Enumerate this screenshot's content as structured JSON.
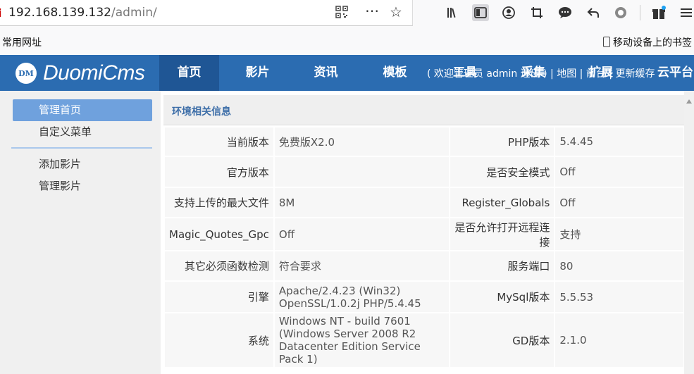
{
  "browser": {
    "url_host": "192.168.139.132",
    "url_path": "/admin/",
    "more_icon": "⋯",
    "star_icon": "☆",
    "toolbar_icons": [
      "library-icon",
      "sidebar-icon",
      "account-icon",
      "crop-icon",
      "chat-icon",
      "back-arrow-icon",
      "puzzle-icon",
      "gift-icon",
      "menu-icon"
    ]
  },
  "bookmarks": {
    "left_label": "常用网址",
    "right_label": "移动设备上的书签"
  },
  "app": {
    "logo_mark": "DM",
    "logo_text": "DuomiCms",
    "nav": [
      "首页",
      "影片",
      "资讯",
      "模板",
      "工具",
      "采集",
      "扩展",
      "云平台"
    ],
    "header_links": "( 欢迎管理员 admin 退出 ) | 地图 | 前台 | 更新缓存"
  },
  "sidebar": {
    "items": [
      "管理首页",
      "自定义菜单",
      "添加影片",
      "管理影片"
    ]
  },
  "panel": {
    "title": "环境相关信息",
    "rows": [
      {
        "l1": "当前版本",
        "v1": "免费版X2.0",
        "l2": "PHP版本",
        "v2": "5.4.45"
      },
      {
        "l1": "官方版本",
        "v1": "",
        "l2": "是否安全模式",
        "v2": "Off"
      },
      {
        "l1": "支持上传的最大文件",
        "v1": "8M",
        "l2": "Register_Globals",
        "v2": "Off"
      },
      {
        "l1": "Magic_Quotes_Gpc",
        "v1": "Off",
        "l2": "是否允许打开远程连接",
        "v2": "支持"
      },
      {
        "l1": "其它必须函数检测",
        "v1": "符合要求",
        "l2": "服务端口",
        "v2": "80"
      },
      {
        "l1": "引擎",
        "v1": "Apache/2.4.23 (Win32) OpenSSL/1.0.2j PHP/5.4.45",
        "l2": "MySql版本",
        "v2": "5.5.53"
      },
      {
        "l1": "系统",
        "v1": "Windows NT - build 7601 (Windows Server 2008 R2 Datacenter Edition Service Pack 1)",
        "l2": "GD版本",
        "v2": "2.1.0"
      }
    ]
  }
}
